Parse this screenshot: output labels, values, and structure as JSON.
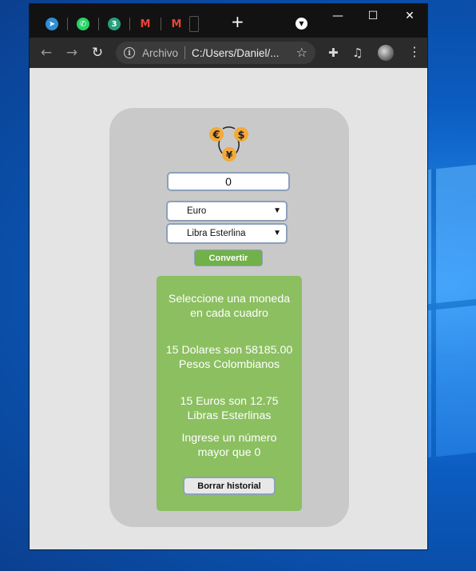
{
  "browser": {
    "tabs": [
      {
        "name": "Telegram",
        "icon": "telegram-icon",
        "color": "#2f8fd8",
        "glyph": "➤"
      },
      {
        "name": "WhatsApp",
        "icon": "whatsapp-icon",
        "color": "#25d366",
        "glyph": "✆"
      },
      {
        "name": "Tab 3",
        "icon": "three-icon",
        "color": "#2a9d7a",
        "glyph": "3"
      },
      {
        "name": "Gmail",
        "icon": "gmail-icon",
        "color": "#ea4335",
        "glyph": "M"
      },
      {
        "name": "Gmail",
        "icon": "gmail-icon",
        "color": "#ea4335",
        "glyph": "M"
      }
    ],
    "new_tab_glyph": "+",
    "window_controls": {
      "minimize": "—",
      "maximize": "☐",
      "close": "✕"
    },
    "address": {
      "security_label": "Archivo",
      "url": "C:/Users/Daniel/..."
    }
  },
  "converter": {
    "amount_value": "0",
    "from_currency": "Euro",
    "to_currency": "Libra Esterlina",
    "convert_label": "Convertir",
    "logo_symbols": [
      "€",
      "$",
      "¥"
    ],
    "history": [
      "Seleccione una moneda en cada cuadro",
      "15 Dolares son 58185.00 Pesos Colombianos",
      "15 Euros son 12.75 Libras Esterlinas",
      "Ingrese un número mayor que 0"
    ],
    "clear_label": "Borrar historial"
  },
  "colors": {
    "card": "#c9c9c9",
    "history_bg": "#8bbf60",
    "convert_bg": "#72b04a",
    "coin": "#f4a93a"
  }
}
